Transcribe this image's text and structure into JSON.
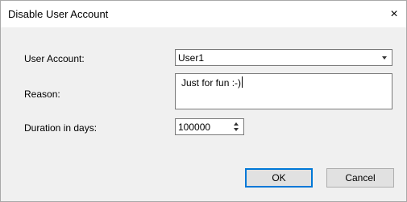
{
  "window": {
    "title": "Disable User Account",
    "close_glyph": "×"
  },
  "form": {
    "user_account_label": "User Account:",
    "user_account_value": "User1",
    "reason_label": "Reason:",
    "reason_value": "Just for fun :-)",
    "duration_label": "Duration in days:",
    "duration_value": "100000"
  },
  "buttons": {
    "ok_label": "OK",
    "cancel_label": "Cancel"
  },
  "colors": {
    "dialog_background": "#f0f0f0",
    "titlebar_background": "#ffffff",
    "default_button_border": "#0078d7"
  }
}
